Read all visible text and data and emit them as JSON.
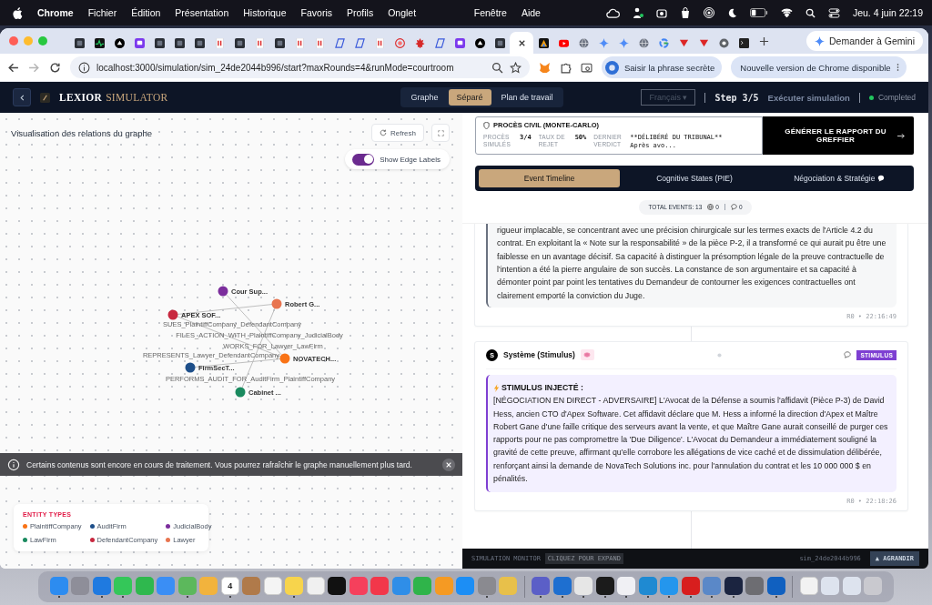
{
  "menu_bar": {
    "app": "Chrome",
    "menus": [
      "Fichier",
      "Édition",
      "Présentation",
      "Historique",
      "Favoris",
      "Profils",
      "Onglet"
    ],
    "menus_right": [
      "Fenêtre",
      "Aide"
    ],
    "clock": "Jeu. 4 juin 22:19"
  },
  "browser": {
    "tabs": [
      {
        "kind": "dark",
        "selected": false
      },
      {
        "kind": "pulse",
        "selected": false
      },
      {
        "kind": "triangle",
        "selected": false
      },
      {
        "kind": "chat",
        "selected": false
      },
      {
        "kind": "dark",
        "selected": false
      },
      {
        "kind": "dark",
        "selected": false
      },
      {
        "kind": "dark",
        "selected": false
      },
      {
        "kind": "doc",
        "selected": false
      },
      {
        "kind": "dark",
        "selected": false
      },
      {
        "kind": "doc",
        "selected": false
      },
      {
        "kind": "dark",
        "selected": false
      },
      {
        "kind": "doc",
        "selected": false
      },
      {
        "kind": "doc",
        "selected": false
      },
      {
        "kind": "slant",
        "selected": false
      },
      {
        "kind": "slant",
        "selected": false
      },
      {
        "kind": "doc",
        "selected": false
      },
      {
        "kind": "target",
        "selected": false
      },
      {
        "kind": "leaf",
        "selected": false
      },
      {
        "kind": "slant",
        "selected": false
      },
      {
        "kind": "chat",
        "selected": false
      },
      {
        "kind": "triangle",
        "selected": false
      },
      {
        "kind": "dark",
        "selected": false
      },
      {
        "kind": "blank",
        "selected": true
      },
      {
        "kind": "colorful",
        "selected": false
      },
      {
        "kind": "play",
        "selected": false
      },
      {
        "kind": "globe",
        "selected": false
      },
      {
        "kind": "sparkle",
        "selected": false
      },
      {
        "kind": "sparkle",
        "selected": false
      },
      {
        "kind": "globe",
        "selected": false
      },
      {
        "kind": "ring",
        "selected": false
      },
      {
        "kind": "vee",
        "selected": false
      },
      {
        "kind": "vee",
        "selected": false
      },
      {
        "kind": "wheel",
        "selected": false
      },
      {
        "kind": "terminal",
        "selected": false
      }
    ],
    "gemini_button": "Demander à Gemini",
    "url": "localhost:3000/simulation/sim_24de2044b996/start?maxRounds=4&runMode=courtroom",
    "passphrase_button": "Saisir la phrase secrète",
    "update_button": "Nouvelle version de Chrome disponible"
  },
  "app_header": {
    "logo_left": "LEXIOR",
    "logo_right": "SIMULATOR",
    "views": [
      {
        "label": "Graphe",
        "selected": false
      },
      {
        "label": "Séparé",
        "selected": true
      },
      {
        "label": "Plan de travail",
        "selected": false
      }
    ],
    "language": "Français ▾",
    "step": "Step 3/5",
    "step_label": "Exécuter simulation",
    "status": "Completed"
  },
  "graph_panel": {
    "title": "Visualisation des relations du graphe",
    "refresh": "Refresh",
    "edge_labels_toggle": {
      "label": "Show Edge Labels",
      "on": true
    },
    "nodes": [
      {
        "label": "Cour Sup...",
        "color": "#7b2d9c"
      },
      {
        "label": "Robert G...",
        "color": "#e8744f"
      },
      {
        "label": "APEX SOF...",
        "color": "#c8283f"
      },
      {
        "label": "NOVATECH...",
        "color": "#f97316"
      },
      {
        "label": "FirmSecT...",
        "color": "#1e4f8a"
      },
      {
        "label": "Cabinet ...",
        "color": "#1a8a5f"
      }
    ],
    "edges": [
      {
        "label": "SUES_PlaintiffCompany_DefendantCompany"
      },
      {
        "label": "FILES_ACTION_WITH_PlaintiffCompany_JudicialBody"
      },
      {
        "label": "WORKS_FOR_Lawyer_LawFirm"
      },
      {
        "label": "REPRESENTS_Lawyer_DefendantCompany"
      },
      {
        "label": "PERFORMS_AUDIT_FOR_AuditFirm_PlaintiffCompany"
      }
    ],
    "toast": "Certains contenus sont encore en cours de traitement. Vous pourrez rafraîchir le graphe manuellement plus tard.",
    "legend": {
      "title": "ENTITY TYPES",
      "items": [
        {
          "label": "PlaintiffCompany",
          "color": "#f97316"
        },
        {
          "label": "AuditFirm",
          "color": "#1e4f8a"
        },
        {
          "label": "JudicialBody",
          "color": "#7b2d9c"
        },
        {
          "label": "LawFirm",
          "color": "#1a8a5f"
        },
        {
          "label": "DefendantCompany",
          "color": "#c8283f"
        },
        {
          "label": "Lawyer",
          "color": "#e8744f"
        }
      ]
    }
  },
  "sim_panel": {
    "card_title": "PROCÈS CIVIL (MONTE-CARLO)",
    "stats": [
      {
        "label": "PROCÈS SIMULÉS",
        "value": "3/4"
      },
      {
        "label": "TAUX DE REJET",
        "value": "50%"
      },
      {
        "label": "DERNIER VERDICT",
        "value": "**DÉLIBÉRÉ DU TRIBUNAL** Après avo..."
      }
    ],
    "report_button": "GÉNÉRER LE RAPPORT DU GREFFIER",
    "tabs": [
      {
        "label": "Event Timeline",
        "selected": true
      },
      {
        "label": "Cognitive States (PIE)",
        "selected": false
      },
      {
        "label": "Négociation & Stratégie",
        "selected": false
      }
    ],
    "totals": {
      "label": "TOTAL EVENTS: 13",
      "world": "0",
      "chat": "0"
    },
    "events": [
      {
        "kind": "message",
        "text": "rigueur implacable, se concentrant avec une précision chirurgicale sur les termes exacts de l'Article 4.2 du contrat. En exploitant la « Note sur la responsabilité » de la pièce P-2, il a transformé ce qui aurait pu être une faiblesse en un avantage décisif. Sa capacité à distinguer la présomption légale de la preuve contractuelle de l'intention a été la pierre angulaire de son succès. La constance de son argumentaire et sa capacité à démonter point par point les tentatives du Demandeur de contourner les exigences contractuelles ont clairement emporté la conviction du Juge.",
        "meta": "R0 • 22:16:49"
      },
      {
        "kind": "stimulus",
        "avatar": "S",
        "author": "Système (Stimulus)",
        "badge": "STIMULUS",
        "heading": "STIMULUS INJECTÉ :",
        "text": "[NÉGOCIATION EN DIRECT - ADVERSAIRE] L'Avocat de la Défense a soumis l'affidavit (Pièce P-3) de David Hess, ancien CTO d'Apex Software. Cet affidavit déclare que M. Hess a informé la direction d'Apex et Maître Robert Gane d'une faille critique des serveurs avant la vente, et que Maître Gane aurait conseillé de purger ces rapports pour ne pas compromettre la 'Due Diligence'. L'Avocat du Demandeur a immédiatement souligné la gravité de cette preuve, affirmant qu'elle corrobore les allégations de vice caché et de dissimulation délibérée, renforçant ainsi la demande de NovaTech Solutions inc. pour l'annulation du contrat et les 10 000 000 $ en pénalités.",
        "meta": "R0 • 22:18:26"
      }
    ],
    "monitor": {
      "title": "SIMULATION MONITOR",
      "hint": "CLIQUEZ POUR EXPAND",
      "sim_id": "sim_24de2044b996",
      "expand_button": "▲ AGRANDIR"
    }
  },
  "dock": [
    {
      "color": "#2d8cf0",
      "running": true
    },
    {
      "color": "#8e8e99",
      "running": false
    },
    {
      "color": "#1f7ae0",
      "running": true
    },
    {
      "color": "#34c759",
      "running": true
    },
    {
      "color": "#2fb84e",
      "running": false
    },
    {
      "color": "#3a8ef5",
      "running": false
    },
    {
      "color": "#5cb85c",
      "running": true
    },
    {
      "color": "#f2b33d",
      "running": false
    },
    {
      "color": "#ffffff",
      "running": true,
      "text": "4"
    },
    {
      "color": "#b07a4a",
      "running": false
    },
    {
      "color": "#f4f4f4",
      "running": false
    },
    {
      "color": "#f7d44c",
      "running": true
    },
    {
      "color": "#f0f0f0",
      "running": false
    },
    {
      "color": "#111111",
      "running": false
    },
    {
      "color": "#f5405c",
      "running": false
    },
    {
      "color": "#f2374a",
      "running": false
    },
    {
      "color": "#2f8ee8",
      "running": false
    },
    {
      "color": "#2fb44a",
      "running": false
    },
    {
      "color": "#f59a23",
      "running": false
    },
    {
      "color": "#1c8ef5",
      "running": false
    },
    {
      "color": "#8a8a90",
      "running": true
    },
    {
      "color": "#e8c04a",
      "running": false
    },
    {
      "color": "#5b5fc7",
      "running": true
    },
    {
      "color": "#1e6fd0",
      "running": true
    },
    {
      "color": "#e6e6e6",
      "running": true
    },
    {
      "color": "#1b1b1b",
      "running": true
    },
    {
      "color": "#f0f0f4",
      "running": true
    },
    {
      "color": "#1f8ad2",
      "running": true
    },
    {
      "color": "#2496ed",
      "running": true
    },
    {
      "color": "#d81e1e",
      "running": true
    },
    {
      "color": "#5a88c8",
      "running": true
    },
    {
      "color": "#1b2440",
      "running": true
    },
    {
      "color": "#6d6d72",
      "running": false
    },
    {
      "color": "#1060c0",
      "running": true
    },
    {
      "color": "#f2f2f2",
      "running": false
    },
    {
      "color": "#dde3ee",
      "running": false
    },
    {
      "color": "#dde3ee",
      "running": false
    },
    {
      "color": "#c9c9cf",
      "running": false
    }
  ]
}
